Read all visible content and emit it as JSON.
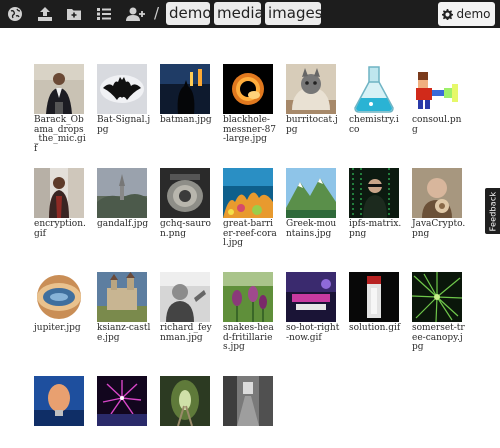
{
  "toolbar": {
    "icons": [
      "globe-icon",
      "upload-icon",
      "new-folder-icon",
      "list-view-icon",
      "add-user-icon"
    ],
    "separator": "/",
    "breadcrumbs": [
      "demo",
      "media",
      "images"
    ],
    "user_label": "demo"
  },
  "feedback_label": "Feedback",
  "files": [
    {
      "name": "Barack_Obama_drops_the_mic.gif",
      "thumb": "obama"
    },
    {
      "name": "Bat-Signal.jpg",
      "thumb": "batsignal"
    },
    {
      "name": "batman.jpg",
      "thumb": "batman"
    },
    {
      "name": "blackhole-messner-87-large.jpg",
      "thumb": "blackhole"
    },
    {
      "name": "burritocat.jpg",
      "thumb": "burritocat"
    },
    {
      "name": "chemistry.ico",
      "thumb": "flask"
    },
    {
      "name": "consoul.png",
      "thumb": "consoul"
    },
    {
      "name": "encryption.gif",
      "thumb": "encryption"
    },
    {
      "name": "gandalf.jpg",
      "thumb": "gandalf"
    },
    {
      "name": "gchq-sauron.png",
      "thumb": "sauron"
    },
    {
      "name": "great-barrier-reef-coral.jpg",
      "thumb": "coral"
    },
    {
      "name": "Greek-mountains.jpg",
      "thumb": "mountains"
    },
    {
      "name": "ipfs-matrix.png",
      "thumb": "matrix"
    },
    {
      "name": "JavaCrypto.png",
      "thumb": "javacrypto"
    },
    {
      "name": "jupiter.jpg",
      "thumb": "jupiter"
    },
    {
      "name": "ksianz-castle.jpg",
      "thumb": "castle"
    },
    {
      "name": "richard_feynman.jpg",
      "thumb": "feynman"
    },
    {
      "name": "snakes-head-fritillaries.jpg",
      "thumb": "fritillaries"
    },
    {
      "name": "so-hot-right-now.gif",
      "thumb": "sohot"
    },
    {
      "name": "solution.gif",
      "thumb": "solution"
    },
    {
      "name": "somerset-tree-canopy.jpg",
      "thumb": "canopy"
    },
    {
      "name": "",
      "thumb": "egg"
    },
    {
      "name": "",
      "thumb": "fireworks"
    },
    {
      "name": "",
      "thumb": "tunnel"
    },
    {
      "name": "",
      "thumb": "street"
    }
  ]
}
